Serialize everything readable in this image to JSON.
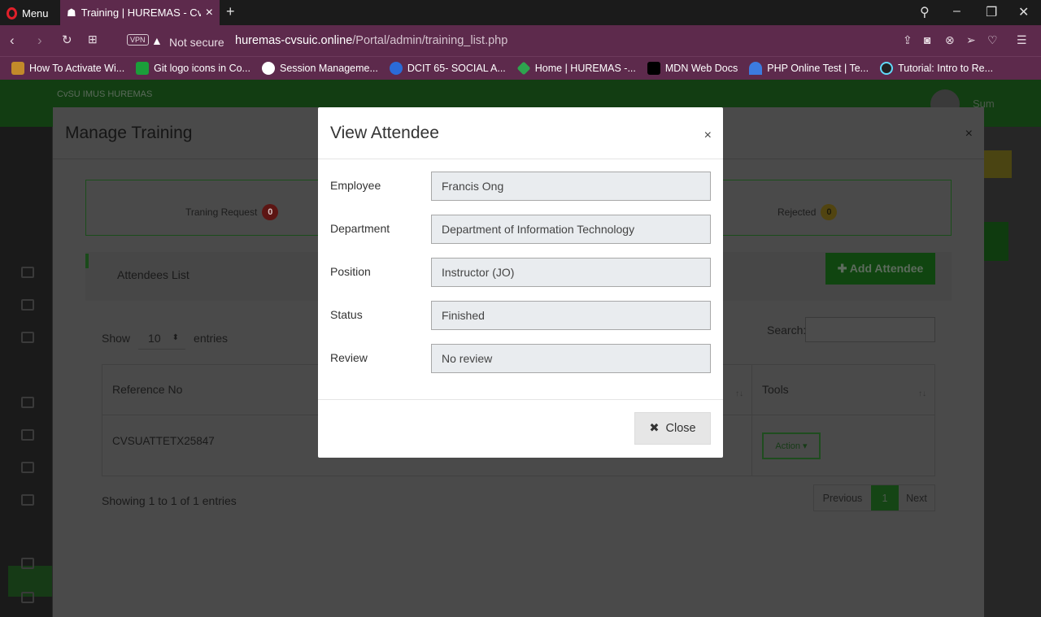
{
  "browser": {
    "menu_label": "Menu",
    "tab_title": "Training | HUREMAS - CvSU",
    "vpn_label": "VPN",
    "not_secure": "Not secure",
    "url_host": "huremas-cvsuic.online",
    "url_path": "/Portal/admin/training_list.php",
    "bookmarks": [
      {
        "label": "How To Activate Wi...",
        "color": "#c28a2a"
      },
      {
        "label": "Git logo icons in Co...",
        "color": "#1b9e3a"
      },
      {
        "label": "Session Manageme...",
        "color": "#ffffff"
      },
      {
        "label": "DCIT 65- SOCIAL A...",
        "color": "#2a6bd8"
      },
      {
        "label": "Home | HUREMAS -...",
        "color": "#2da44e"
      },
      {
        "label": "MDN Web Docs",
        "color": "#000000"
      },
      {
        "label": "PHP Online Test | Te...",
        "color": "#3c7be0"
      },
      {
        "label": "Tutorial: Intro to Re...",
        "color": "#61dafb"
      }
    ]
  },
  "background_page": {
    "brand": "CvSU IMUS HUREMAS",
    "user_name": "Sum"
  },
  "manage_modal": {
    "title": "Manage Training",
    "close": "×",
    "status": {
      "request_label": "Traning Request",
      "request_count": "0",
      "rejected_label": "Rejected",
      "rejected_count": "0"
    },
    "attendees_title": "Attendees List",
    "add_button": "✚ Add Attendee",
    "show_label": "Show",
    "entries_value": "10",
    "entries_label": "entries",
    "search_label": "Search:",
    "columns": {
      "ref": "Reference No",
      "tools": "Tools"
    },
    "rows": [
      {
        "ref": "CVSUATTETX25847",
        "action": "Action ▾"
      }
    ],
    "showing": "Showing 1 to 1 of 1 entries",
    "pager": {
      "prev": "Previous",
      "page": "1",
      "next": "Next"
    }
  },
  "view_modal": {
    "title": "View Attendee",
    "close_x": "×",
    "fields": [
      {
        "label": "Employee",
        "value": "Francis Ong"
      },
      {
        "label": "Department",
        "value": "Department of Information Technology"
      },
      {
        "label": "Position",
        "value": "Instructor (JO)"
      },
      {
        "label": "Status",
        "value": "Finished"
      },
      {
        "label": "Review",
        "value": "No review"
      }
    ],
    "close_button": "Close",
    "close_icon": "✖"
  }
}
